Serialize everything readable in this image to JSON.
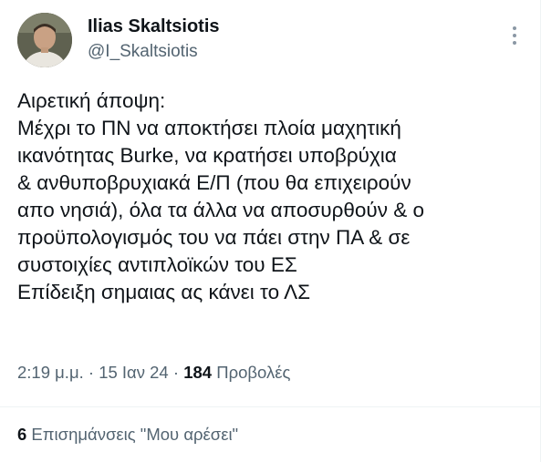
{
  "author": {
    "name": "Ilias Skaltsiotis",
    "handle": "@I_Skaltsiotis"
  },
  "more_icon": "more-vertical-icon",
  "tweet": {
    "lines": [
      "Αιρετική άποψη:",
      "Μέχρι το ΠΝ να αποκτήσει πλοία μαχητική",
      "ικανότητας Burke, να κρατήσει υποβρύχια",
      "& ανθυποβρυχιακά Ε/Π (που θα επιχειρούν",
      "απο νησιά), όλα τα άλλα να αποσυρθούν & ο",
      "προϋπολογισμός του να πάει στην ΠΑ & σε",
      "συστοιχίες αντιπλοϊκών του ΕΣ",
      "Επίδειξη σημαιας ας κάνει το ΛΣ"
    ]
  },
  "meta": {
    "time": "2:19 μ.μ.",
    "separator1": " · ",
    "date": "15 Ιαν 24",
    "separator2": " · ",
    "views_count": "184",
    "views_label": " Προβολές"
  },
  "engagement": {
    "likes_count": "6",
    "likes_label": " Επισημάνσεις \"Μου αρέσει\""
  },
  "colors": {
    "text": "#0f1419",
    "secondary": "#536471",
    "divider": "#eff3f4"
  }
}
